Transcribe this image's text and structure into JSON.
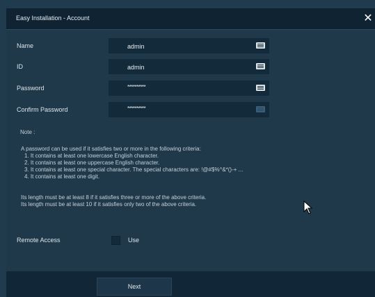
{
  "dialog": {
    "title": "Easy Installation - Account",
    "close_glyph": "✕"
  },
  "fields": {
    "name_label": "Name",
    "name_value": "admin",
    "id_label": "ID",
    "id_value": "admin",
    "password_label": "Password",
    "password_value": "**********",
    "confirm_label": "Confirm Password",
    "confirm_value": "**********"
  },
  "note": {
    "heading": "Note :",
    "intro": "A password can be used if it satisfies two or more in the following criteria:",
    "criteria": [
      "1. It contains at least one lowercase English character.",
      "2. It contains at least one uppercase English character.",
      "3. It contains at least one special character. The special characters are: !@#$%^&*()-+ ...",
      "4. It contains at least one digit."
    ],
    "length_rule_1": "Its length must be at least 8 if it satisfies three or more of the above criteria.",
    "length_rule_2": "Its length must be at least 10 if it satisfies only two of the above criteria."
  },
  "remote_access": {
    "label": "Remote Access",
    "checkbox_label": "Use",
    "checked": false
  },
  "footer": {
    "next_label": "Next"
  },
  "icons": {
    "keyboard": "keyboard-icon",
    "close": "close-icon",
    "cursor": "mouse-cursor-icon"
  }
}
